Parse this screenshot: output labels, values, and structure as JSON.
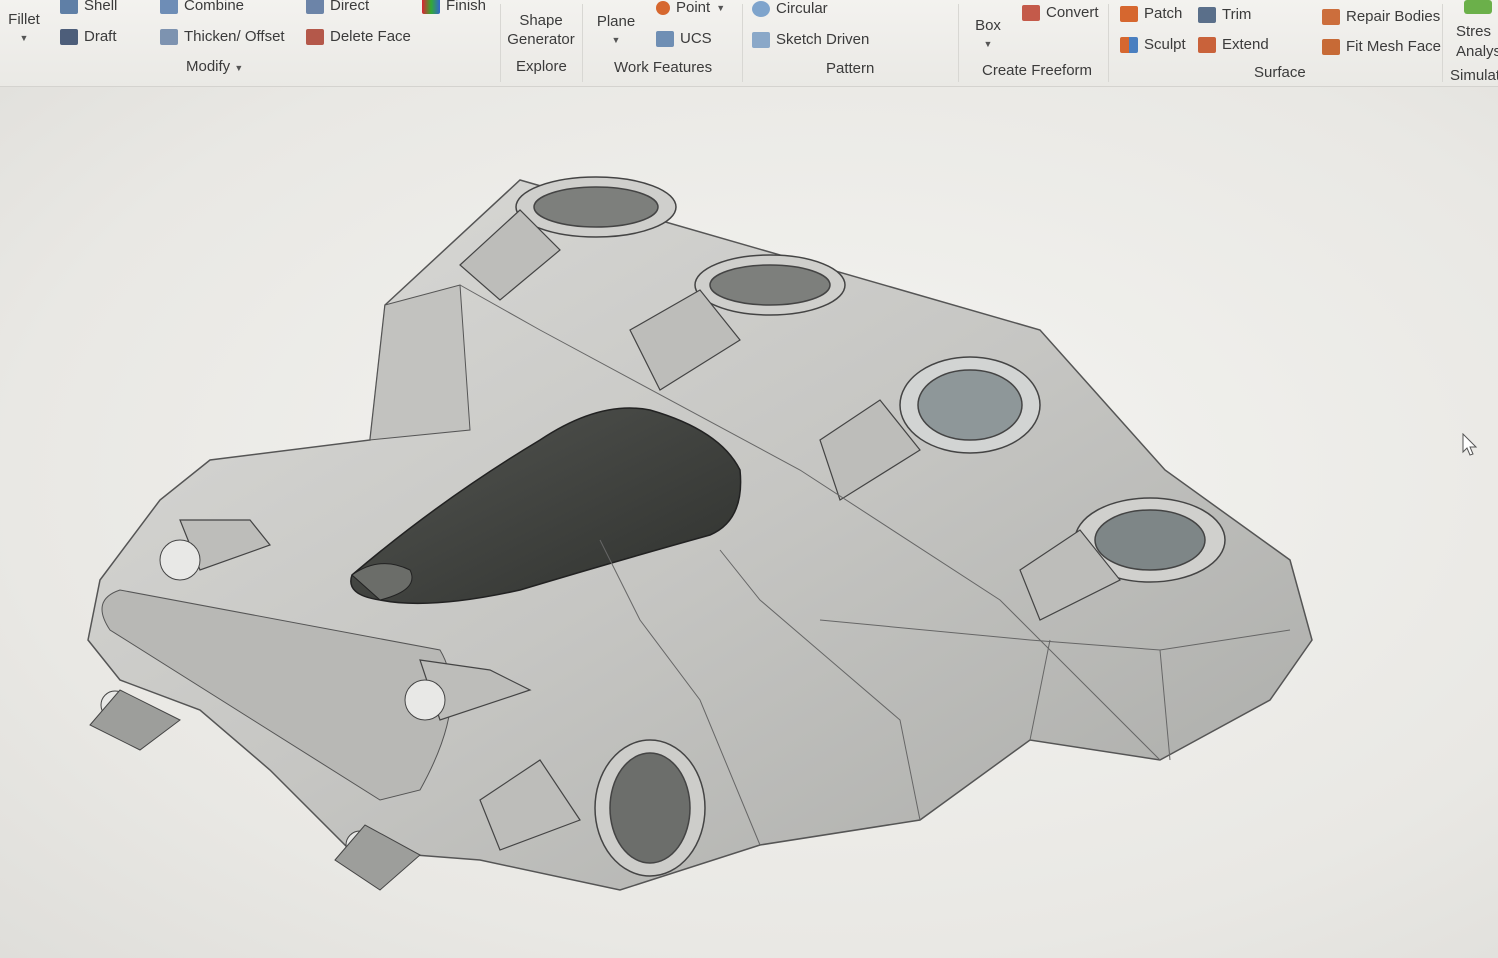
{
  "ribbon": {
    "fillet": "Fillet",
    "shell": "Shell",
    "draft": "Draft",
    "combine": "Combine",
    "thicken": "Thicken/ Offset",
    "direct": "Direct",
    "delete_face": "Delete Face",
    "finish": "Finish",
    "modify": "Modify",
    "shape_generator": "Shape Generator",
    "explore": "Explore",
    "plane": "Plane",
    "point": "Point",
    "ucs": "UCS",
    "work_features": "Work Features",
    "circular": "Circular",
    "sketch_driven": "Sketch Driven",
    "pattern": "Pattern",
    "box": "Box",
    "convert": "Convert",
    "create_freeform": "Create Freeform",
    "patch": "Patch",
    "trim": "Trim",
    "sculpt": "Sculpt",
    "extend": "Extend",
    "surface": "Surface",
    "repair_bodies": "Repair Bodies",
    "fit_mesh_face": "Fit Mesh Face",
    "stress_analysis": "Stres Analys",
    "simulation": "Simulat"
  },
  "colors": {
    "accent_orange": "#d6672f",
    "accent_blue": "#4a7fc0",
    "model_gray": "#c9c9c6",
    "model_dark": "#3d3f3c"
  }
}
